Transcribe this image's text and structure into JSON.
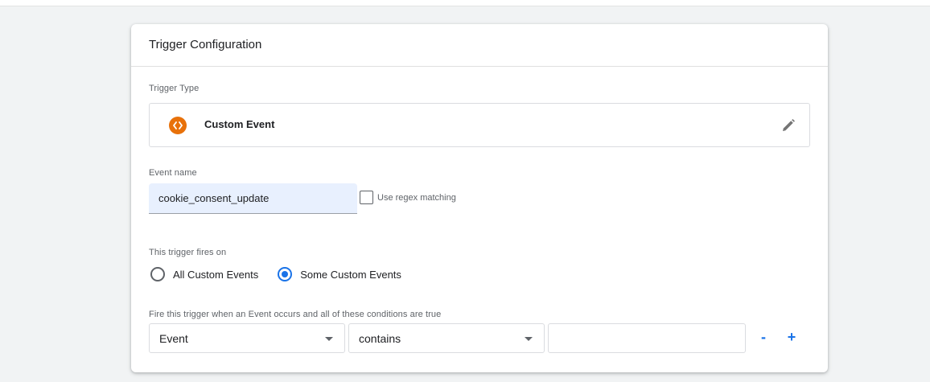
{
  "card": {
    "title": "Trigger Configuration"
  },
  "trigger_type": {
    "label": "Trigger Type",
    "name": "Custom Event",
    "icon": "code-brackets-icon",
    "icon_color": "#e8710a"
  },
  "event_name": {
    "label": "Event name",
    "value": "cookie_consent_update",
    "regex_label": "Use regex matching",
    "regex_checked": false
  },
  "fires_on": {
    "label": "This trigger fires on",
    "options": [
      {
        "label": "All Custom Events",
        "checked": false
      },
      {
        "label": "Some Custom Events",
        "checked": true
      }
    ]
  },
  "conditions": {
    "label": "Fire this trigger when an Event occurs and all of these conditions are true",
    "variable": "Event",
    "operator": "contains",
    "value": "",
    "remove_label": "-",
    "add_label": "+"
  },
  "colors": {
    "accent": "#1a73e8",
    "input_bg": "#e8f0fe"
  }
}
